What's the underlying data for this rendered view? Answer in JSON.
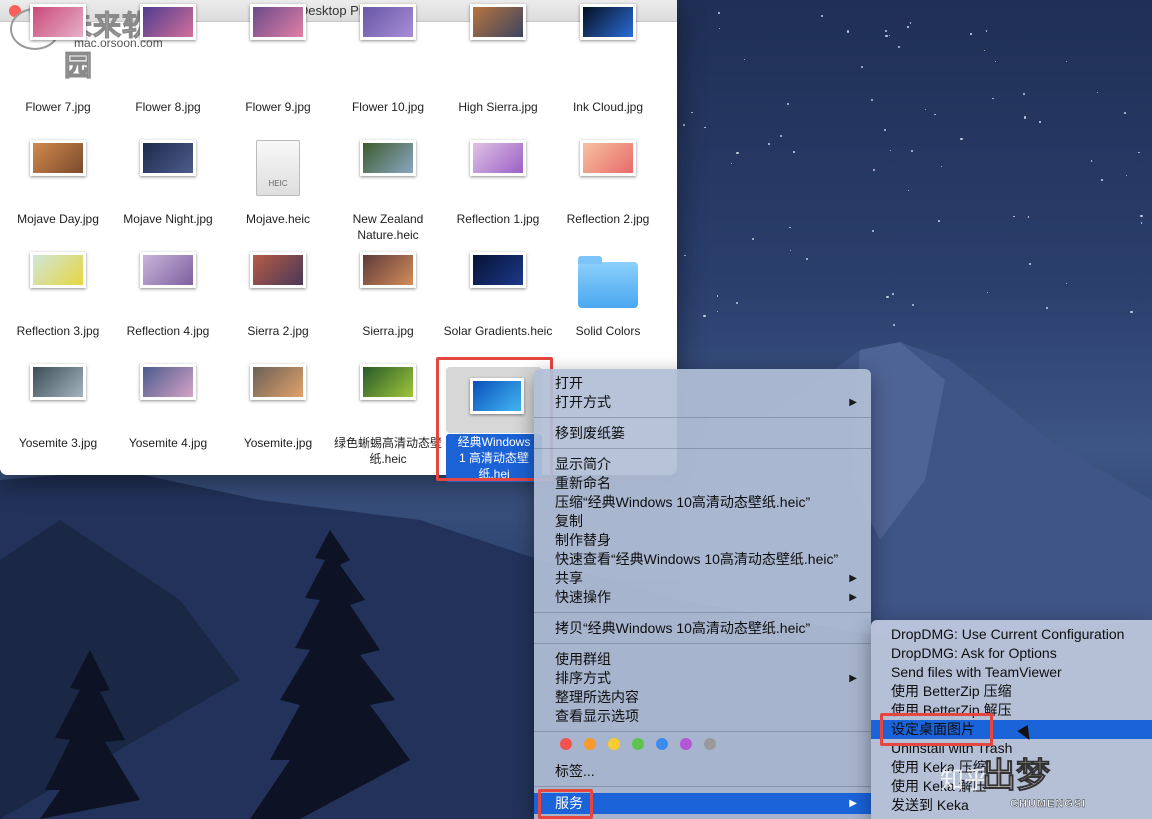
{
  "window": {
    "title": "Desktop Pictures"
  },
  "watermark_top": {
    "name": "未来软件园",
    "url": "mac.orsoon.com"
  },
  "watermark_bottom": {
    "text1": "知乎",
    "logo": "出梦",
    "en": "CHUMENGSI"
  },
  "files": [
    {
      "name": "Flower 7.jpg",
      "colors": [
        "#c94a7a",
        "#e7b0c8"
      ]
    },
    {
      "name": "Flower 8.jpg",
      "colors": [
        "#4f3c8f",
        "#d36f9b"
      ]
    },
    {
      "name": "Flower 9.jpg",
      "colors": [
        "#6a4a8a",
        "#e17fa6"
      ]
    },
    {
      "name": "Flower 10.jpg",
      "colors": [
        "#6657a5",
        "#a98ed8"
      ]
    },
    {
      "name": "High Sierra.jpg",
      "colors": [
        "#b7753d",
        "#3c4461"
      ]
    },
    {
      "name": "Ink Cloud.jpg",
      "colors": [
        "#06101f",
        "#2b6dd8"
      ]
    },
    {
      "name": "Mojave Day.jpg",
      "colors": [
        "#d28a4c",
        "#7a4a2d"
      ]
    },
    {
      "name": "Mojave Night.jpg",
      "colors": [
        "#1d2a4c",
        "#4d5d8b"
      ]
    },
    {
      "name": "Mojave.heic",
      "doc": "HEIC"
    },
    {
      "name": "New Zealand Nature.heic",
      "colors": [
        "#3d5a2d",
        "#8aa8c3"
      ]
    },
    {
      "name": "Reflection 1.jpg",
      "colors": [
        "#e0c3e3",
        "#9b5fc7"
      ]
    },
    {
      "name": "Reflection 2.jpg",
      "colors": [
        "#f6c2a0",
        "#e86a6a"
      ]
    },
    {
      "name": "Reflection 3.jpg",
      "colors": [
        "#cfe6d9",
        "#e6d640"
      ]
    },
    {
      "name": "Reflection 4.jpg",
      "colors": [
        "#c9b5db",
        "#7d5f9e"
      ]
    },
    {
      "name": "Sierra 2.jpg",
      "colors": [
        "#b55c45",
        "#4a3858"
      ]
    },
    {
      "name": "Sierra.jpg",
      "colors": [
        "#5e3b3a",
        "#d48d5a"
      ]
    },
    {
      "name": "Solar Gradients.heic",
      "colors": [
        "#061134",
        "#1c3a8a"
      ]
    },
    {
      "name": "Solid Colors",
      "folder": true
    },
    {
      "name": "Yosemite 3.jpg",
      "colors": [
        "#3c4d58",
        "#a4b4bf"
      ]
    },
    {
      "name": "Yosemite 4.jpg",
      "colors": [
        "#4b5c8c",
        "#d6a2c7"
      ]
    },
    {
      "name": "Yosemite.jpg",
      "colors": [
        "#6b6057",
        "#e0a26a"
      ]
    },
    {
      "name": "绿色蜥蜴高清动态壁纸.heic",
      "colors": [
        "#275a2a",
        "#a0c63a"
      ]
    }
  ],
  "selected_file": {
    "name": "经典Windows 10高清动态壁纸.heic",
    "label": "经典Windows 1 高清动态壁纸.hei",
    "colors": [
      "#0a4fb8",
      "#42b8f5"
    ]
  },
  "context_menu": {
    "items": [
      {
        "label": "打开"
      },
      {
        "label": "打开方式",
        "submenu": true
      },
      {
        "sep": true
      },
      {
        "label": "移到废纸篓"
      },
      {
        "sep": true
      },
      {
        "label": "显示简介"
      },
      {
        "label": "重新命名"
      },
      {
        "label": "压缩“经典Windows 10高清动态壁纸.heic”"
      },
      {
        "label": "复制"
      },
      {
        "label": "制作替身"
      },
      {
        "label": "快速查看“经典Windows 10高清动态壁纸.heic”"
      },
      {
        "label": "共享",
        "submenu": true
      },
      {
        "label": "快速操作",
        "submenu": true
      },
      {
        "sep": true
      },
      {
        "label": "拷贝“经典Windows 10高清动态壁纸.heic”"
      },
      {
        "sep": true
      },
      {
        "label": "使用群组"
      },
      {
        "label": "排序方式",
        "submenu": true
      },
      {
        "label": "整理所选内容"
      },
      {
        "label": "查看显示选项"
      },
      {
        "sep": true
      },
      {
        "tags": true
      },
      {
        "label": "标签..."
      },
      {
        "sep": true
      },
      {
        "label": "服务",
        "submenu": true,
        "highlighted": true
      }
    ],
    "tag_colors": [
      "#f2534d",
      "#f89b2e",
      "#f7cc2e",
      "#5cc44c",
      "#3b8cf0",
      "#b258d6",
      "#9a9a9a"
    ]
  },
  "services_submenu": {
    "items": [
      {
        "label": "DropDMG: Use Current Configuration"
      },
      {
        "label": "DropDMG: Ask for Options"
      },
      {
        "label": "Send files with TeamViewer"
      },
      {
        "label": "使用 BetterZip 压缩"
      },
      {
        "label": "使用 BetterZip 解压"
      },
      {
        "label": "设定桌面图片",
        "highlighted": true
      },
      {
        "label": "Uninstall with Trash"
      },
      {
        "label": "使用 Keka 压缩"
      },
      {
        "label": "使用 Keka 解压"
      },
      {
        "label": "发送到 Keka"
      }
    ]
  }
}
